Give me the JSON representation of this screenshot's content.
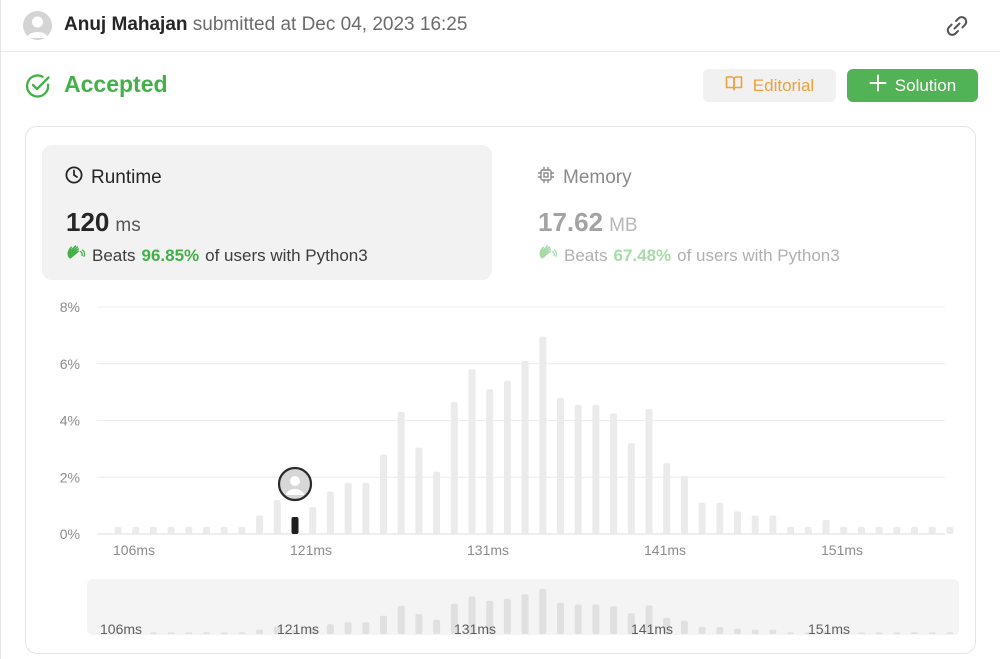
{
  "header": {
    "user_name": "Anuj Mahajan",
    "submitted_text": "submitted at Dec 04, 2023 16:25",
    "icons": {
      "avatar": "user-avatar-icon",
      "share": "link-icon"
    }
  },
  "status": {
    "label": "Accepted",
    "color": "#43b049",
    "icon": "check-circle-icon"
  },
  "buttons": {
    "editorial": "Editorial",
    "solution": "Solution"
  },
  "runtime": {
    "title": "Runtime",
    "value": "120",
    "unit": "ms",
    "beats_prefix": "Beats",
    "beats_pct": "96.85%",
    "beats_suffix": "of users with Python3",
    "icon": "clock-icon"
  },
  "memory": {
    "title": "Memory",
    "value": "17.62",
    "unit": "MB",
    "beats_prefix": "Beats",
    "beats_pct": "67.48%",
    "beats_suffix": "of users with Python3",
    "icon": "chip-icon"
  },
  "chart_data": {
    "type": "bar",
    "y_ticks": [
      "0%",
      "2%",
      "4%",
      "6%",
      "8%"
    ],
    "ylim": [
      0,
      8
    ],
    "x_tick_labels": [
      "106ms",
      "121ms",
      "131ms",
      "141ms",
      "151ms"
    ],
    "values": [
      0.25,
      0.25,
      0.25,
      0.25,
      0.25,
      0.25,
      0.25,
      0.25,
      0.65,
      1.2,
      0.6,
      0.95,
      1.5,
      1.8,
      1.8,
      2.8,
      4.3,
      3.05,
      2.2,
      4.65,
      5.8,
      5.1,
      5.4,
      6.1,
      6.95,
      4.8,
      4.55,
      4.55,
      4.25,
      3.2,
      4.4,
      2.5,
      2.05,
      1.1,
      1.1,
      0.8,
      0.65,
      0.65,
      0.25,
      0.25,
      0.5,
      0.25,
      0.25,
      0.25,
      0.25,
      0.25,
      0.25,
      0.25
    ],
    "highlight_index": 10,
    "bar_color": "#ebebeb",
    "highlight_color": "#1f1f1f",
    "grid": true
  }
}
